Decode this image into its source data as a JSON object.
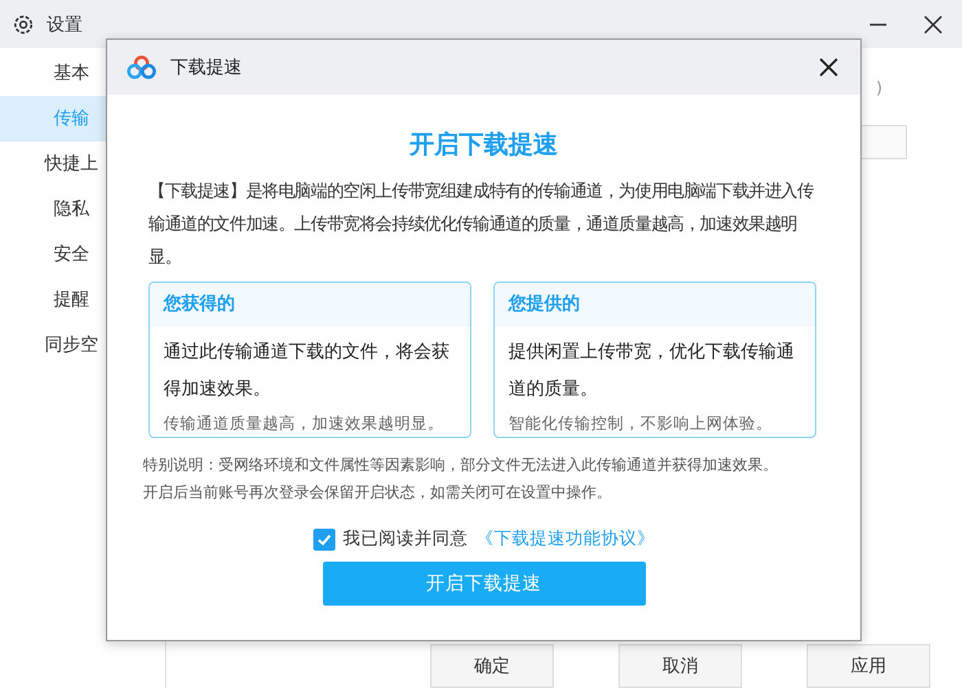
{
  "window": {
    "title": "设置"
  },
  "sidebar": {
    "items": [
      {
        "label": "基本",
        "selected": false
      },
      {
        "label": "传输",
        "selected": true
      },
      {
        "label": "快捷上",
        "selected": false
      },
      {
        "label": "隐私",
        "selected": false
      },
      {
        "label": "安全",
        "selected": false
      },
      {
        "label": "提醒",
        "selected": false
      },
      {
        "label": "同步空",
        "selected": false
      }
    ]
  },
  "content": {
    "partial_text": ")"
  },
  "footer_buttons": [
    "确定",
    "取消",
    "应用"
  ],
  "dialog": {
    "title": "下载提速",
    "heading": "开启下载提速",
    "intro": "【下载提速】是将电脑端的空闲上传带宽组建成特有的传输通道，为使用电脑端下载并进入传输通道的文件加速。上传带宽将会持续优化传输通道的质量，通道质量越高，加速效果越明显。",
    "cards": [
      {
        "title": "您获得的",
        "body": "通过此传输通道下载的文件，将会获得加速效果。",
        "note": "传输通道质量越高，加速效果越明显。"
      },
      {
        "title": "您提供的",
        "body": "提供闲置上传带宽，优化下载传输通道的质量。",
        "note": "智能化传输控制，不影响上网体验。"
      }
    ],
    "notes": [
      "特别说明：受网络环境和文件属性等因素影响，部分文件无法进入此传输通道并获得加速效果。",
      "开启后当前账号再次登录会保留开启状态，如需关闭可在设置中操作。"
    ],
    "agreement": {
      "checked": true,
      "label": "我已阅读并同意",
      "link": "《下载提速功能协议》"
    },
    "primary_button": "开启下载提速"
  }
}
